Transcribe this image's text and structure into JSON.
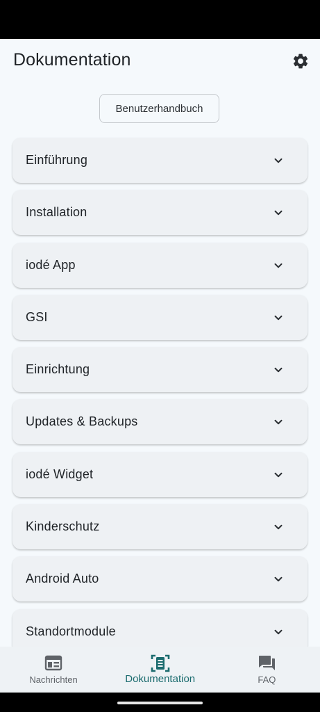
{
  "header": {
    "title": "Dokumentation",
    "settings_icon": "gear-icon"
  },
  "manual_button": "Benutzerhandbuch",
  "sections": [
    "Einführung",
    "Installation",
    "iodé App",
    "GSI",
    "Einrichtung",
    "Updates & Backups",
    "iodé Widget",
    "Kinderschutz",
    "Android Auto",
    "Standortmodule"
  ],
  "bottom_nav": [
    {
      "label": "Nachrichten",
      "icon": "news-icon",
      "active": false
    },
    {
      "label": "Dokumentation",
      "icon": "document-icon",
      "active": true
    },
    {
      "label": "FAQ",
      "icon": "chat-bubbles-icon",
      "active": false
    }
  ],
  "colors": {
    "accent": "#1a6b6e",
    "background": "#f5f9fc",
    "card": "#eef1f4"
  }
}
